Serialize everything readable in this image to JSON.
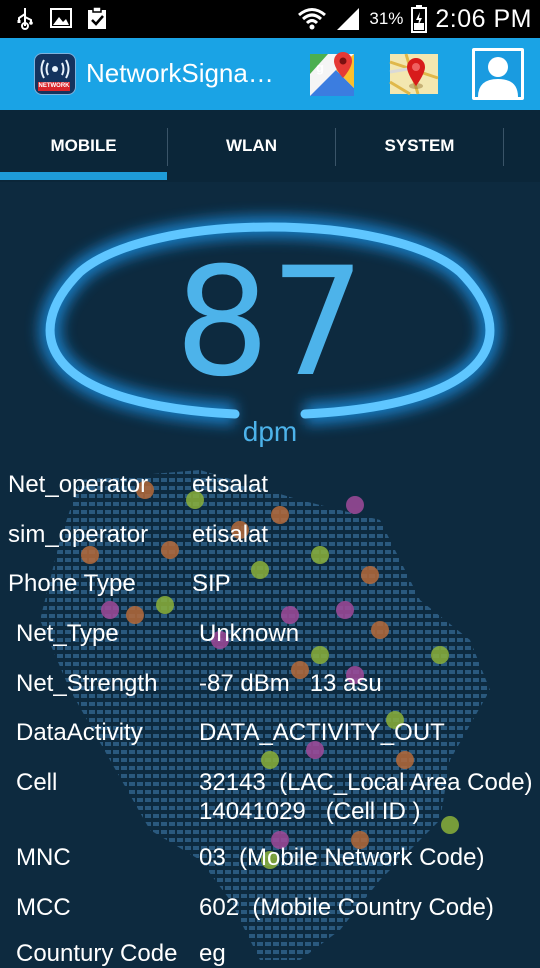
{
  "status_bar": {
    "icons": [
      "usb-icon",
      "image-icon",
      "clipboard-check-icon",
      "wifi-icon",
      "signal-icon",
      "battery-icon"
    ],
    "battery_percent": "31%",
    "time": "2:06 PM"
  },
  "action_bar": {
    "app_icon_text": "NETWORK",
    "title": "NetworkSigna…",
    "buttons": [
      "google-maps-icon",
      "map-pin-icon",
      "profile-icon"
    ]
  },
  "tabs": [
    "MOBILE",
    "WLAN",
    "SYSTEM"
  ],
  "selected_tab": "MOBILE",
  "gauge": {
    "value": "87",
    "unit": "dpm"
  },
  "info_rows": [
    {
      "label": "Net_operator",
      "value": "etisalat"
    },
    {
      "label": "sim_operator",
      "value": "etisalat"
    },
    {
      "label": "Phone Type",
      "value": "SIP"
    },
    {
      "label": "Net_Type",
      "value": "Unknown"
    },
    {
      "label": "Net_Strength",
      "value": "-87 dBm   13 asu"
    },
    {
      "label": "DataActivity",
      "value": "DATA_ACTIVITY_OUT"
    },
    {
      "label": "Cell",
      "value": "32143  (LAC_Local Area Code)",
      "value2": "14041029   (Cell ID )"
    },
    {
      "label": "MNC",
      "value": "03  (Mobile Network Code)"
    },
    {
      "label": "MCC",
      "value": "602  (Mobile Country Code)"
    },
    {
      "label": "Countury Code",
      "value": "eg"
    }
  ],
  "colors": {
    "action_bar": "#1aa3e5",
    "background": "#0d2a3f",
    "accent": "#4db3ea"
  }
}
